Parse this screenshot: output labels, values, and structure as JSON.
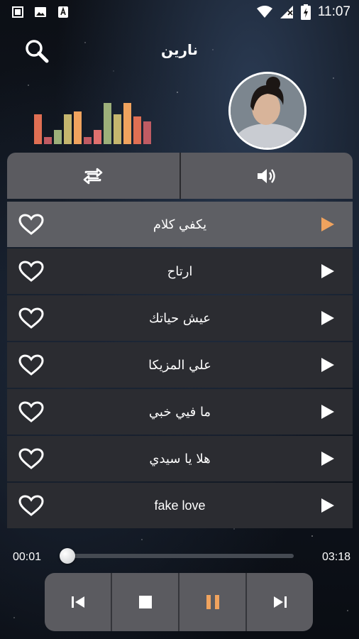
{
  "status_bar": {
    "time": "11:07"
  },
  "header": {
    "title": "نارين"
  },
  "equalizer": {
    "levels": [
      0.72,
      0.18,
      0.35,
      0.72,
      0.8,
      0.18,
      0.35,
      1.0,
      0.72,
      1.0,
      0.68,
      0.55
    ],
    "colors": [
      "#e06f53",
      "#c05b63",
      "#9db07a",
      "#c5b66e",
      "#f0a35e",
      "#c05b63",
      "#e0706e",
      "#9db07a",
      "#c5b66e",
      "#f0a35e",
      "#e06f53",
      "#c05b63"
    ]
  },
  "tracks": [
    {
      "name": "يكفي كلام",
      "active": true
    },
    {
      "name": "ارتاح",
      "active": false
    },
    {
      "name": "عيش حياتك",
      "active": false
    },
    {
      "name": "علي المزيكا",
      "active": false
    },
    {
      "name": "ما فيي خبي",
      "active": false
    },
    {
      "name": "هلا يا سيدي",
      "active": false
    },
    {
      "name": "fake love",
      "active": false
    }
  ],
  "progress": {
    "current": "00:01",
    "total": "03:18",
    "fraction": 0.005
  },
  "colors": {
    "accent": "#f0a35e",
    "panel": "#5b5b60",
    "row": "#2b2c31",
    "row_active": "#5e5f64"
  },
  "icons": {
    "search": "search-icon",
    "repeat": "repeat-icon",
    "volume": "volume-icon",
    "heart": "heart-outline-icon",
    "play": "play-icon",
    "previous": "skip-previous-icon",
    "stop": "stop-icon",
    "pause": "pause-icon",
    "next": "skip-next-icon"
  }
}
